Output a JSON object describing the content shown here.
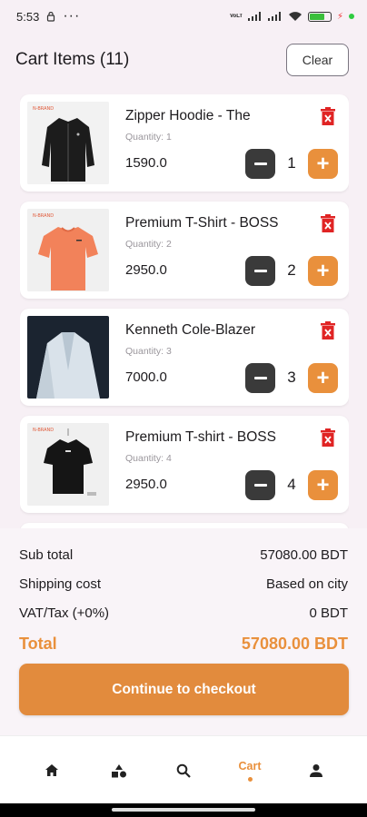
{
  "status_bar": {
    "time": "5:53",
    "network_label": "VoLTE",
    "dots": "···"
  },
  "header": {
    "title": "Cart Items (11)",
    "clear_label": "Clear"
  },
  "cart_items": [
    {
      "name": "Zipper Hoodie - The",
      "quantity_label": "Quantity: 1",
      "price": "1590.0",
      "quantity": "1",
      "image": "black-zipper-hoodie"
    },
    {
      "name": "Premium T-Shirt - BOSS",
      "quantity_label": "Quantity: 2",
      "price": "2950.0",
      "quantity": "2",
      "image": "orange-tshirt"
    },
    {
      "name": "Kenneth Cole-Blazer",
      "quantity_label": "Quantity: 3",
      "price": "7000.0",
      "quantity": "3",
      "image": "white-blazer"
    },
    {
      "name": "Premium T-shirt - BOSS",
      "quantity_label": "Quantity: 4",
      "price": "2950.0",
      "quantity": "4",
      "image": "black-tshirt"
    }
  ],
  "summary": {
    "subtotal_label": "Sub total",
    "subtotal_value": "57080.00 BDT",
    "shipping_label": "Shipping cost",
    "shipping_value": "Based on city",
    "vat_label": "VAT/Tax (+0%)",
    "vat_value": "0 BDT",
    "total_label": "Total",
    "total_value": "57080.00 BDT",
    "checkout_label": "Continue to checkout"
  },
  "nav": {
    "items": [
      {
        "icon": "home-icon",
        "label": ""
      },
      {
        "icon": "categories-icon",
        "label": ""
      },
      {
        "icon": "search-icon",
        "label": ""
      },
      {
        "icon": "cart-tab",
        "label": "Cart"
      },
      {
        "icon": "profile-icon",
        "label": ""
      }
    ],
    "active": "Cart"
  },
  "colors": {
    "accent": "#e9903c",
    "dark_button": "#3a3a3a",
    "delete": "#e02424",
    "background": "#f7f0f5"
  }
}
